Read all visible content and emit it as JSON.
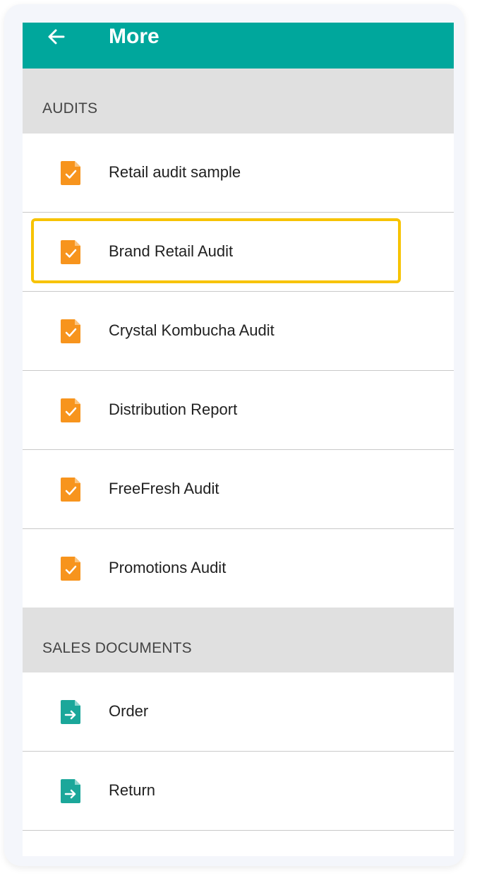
{
  "app_bar": {
    "title": "More",
    "back_icon": "arrow-left-icon"
  },
  "sections": {
    "audits": {
      "header": "AUDITS"
    },
    "sales": {
      "header": "SALES DOCUMENTS"
    }
  },
  "audits": [
    {
      "label": "Retail audit sample",
      "icon": "audit-document-icon"
    },
    {
      "label": "Brand Retail Audit",
      "icon": "audit-document-icon"
    },
    {
      "label": "Crystal Kombucha Audit",
      "icon": "audit-document-icon"
    },
    {
      "label": "Distribution Report",
      "icon": "audit-document-icon"
    },
    {
      "label": "FreeFresh Audit",
      "icon": "audit-document-icon"
    },
    {
      "label": "Promotions Audit",
      "icon": "audit-document-icon"
    }
  ],
  "sales_documents": [
    {
      "label": "Order",
      "icon": "sales-document-icon"
    },
    {
      "label": "Return",
      "icon": "sales-document-icon"
    }
  ],
  "colors": {
    "accent": "#00A79C",
    "audit_icon": "#F7941D",
    "sales_icon": "#1BA79A",
    "highlight": "#F7C300",
    "section_bg": "#E0E0E0"
  }
}
